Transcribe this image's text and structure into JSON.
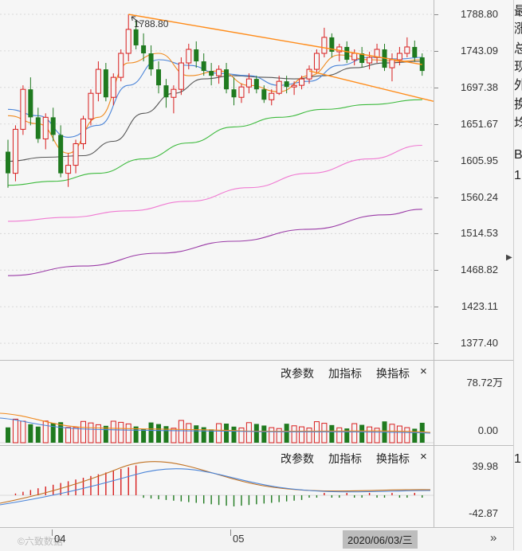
{
  "price_axis": {
    "labels": [
      "1788.80",
      "1743.09",
      "1697.38",
      "1651.67",
      "1605.95",
      "1560.24",
      "1514.53",
      "1468.82",
      "1423.11",
      "1377.40"
    ]
  },
  "high_marker": "1788.80",
  "panels": {
    "volume": {
      "buttons": [
        "改参数",
        "加指标",
        "换指标"
      ],
      "close": "×",
      "top_label": "78.72万",
      "bottom_label": "0.00"
    },
    "macd": {
      "buttons": [
        "改参数",
        "加指标",
        "换指标"
      ],
      "close": "×",
      "top_label": "39.98",
      "bottom_label": "-42.87"
    }
  },
  "time_axis": {
    "month_labels": [
      "04",
      "05"
    ],
    "date_badge": "2020/06/03/三",
    "scroll_glyph": "»"
  },
  "watermark": "©六致数据",
  "side_arrow": "▶",
  "right_clipped_chars": [
    "最",
    "涨",
    "总",
    "现",
    "外",
    "换",
    "均",
    "B",
    "1",
    "1"
  ],
  "colors": {
    "up": "#d81e1e",
    "down": "#1f7a1f",
    "ma5": "#f08a1e",
    "ma10": "#4a84d8",
    "ma20": "#555555",
    "ma60": "#3cba3c",
    "ma120": "#f07ad2",
    "ma250": "#9a3aa6",
    "trend": "#ff8c1a",
    "bg": "#f6f6f6"
  },
  "chart_data": {
    "type": "candlestick",
    "y_range": [
      1355,
      1800
    ],
    "candles": [
      [
        1617,
        1632,
        1572,
        1590
      ],
      [
        1590,
        1650,
        1580,
        1645
      ],
      [
        1645,
        1700,
        1638,
        1695
      ],
      [
        1695,
        1710,
        1650,
        1660
      ],
      [
        1660,
        1672,
        1628,
        1633
      ],
      [
        1633,
        1665,
        1620,
        1660
      ],
      [
        1660,
        1672,
        1630,
        1638
      ],
      [
        1638,
        1650,
        1585,
        1590
      ],
      [
        1590,
        1615,
        1573,
        1600
      ],
      [
        1600,
        1632,
        1590,
        1627
      ],
      [
        1627,
        1662,
        1620,
        1658
      ],
      [
        1658,
        1695,
        1650,
        1690
      ],
      [
        1690,
        1730,
        1680,
        1720
      ],
      [
        1720,
        1728,
        1680,
        1685
      ],
      [
        1685,
        1715,
        1675,
        1710
      ],
      [
        1710,
        1745,
        1705,
        1740
      ],
      [
        1740,
        1788.8,
        1730,
        1770
      ],
      [
        1770,
        1782,
        1745,
        1750
      ],
      [
        1750,
        1765,
        1730,
        1740
      ],
      [
        1740,
        1750,
        1712,
        1720
      ],
      [
        1720,
        1730,
        1690,
        1700
      ],
      [
        1700,
        1708,
        1672,
        1685
      ],
      [
        1685,
        1700,
        1665,
        1695
      ],
      [
        1695,
        1735,
        1688,
        1728
      ],
      [
        1728,
        1752,
        1720,
        1745
      ],
      [
        1745,
        1755,
        1722,
        1730
      ],
      [
        1730,
        1740,
        1712,
        1718
      ],
      [
        1718,
        1728,
        1700,
        1712
      ],
      [
        1712,
        1725,
        1702,
        1720
      ],
      [
        1720,
        1728,
        1690,
        1695
      ],
      [
        1695,
        1710,
        1675,
        1685
      ],
      [
        1685,
        1702,
        1678,
        1698
      ],
      [
        1698,
        1715,
        1690,
        1708
      ],
      [
        1708,
        1712,
        1690,
        1695
      ],
      [
        1695,
        1700,
        1678,
        1682
      ],
      [
        1682,
        1695,
        1675,
        1690
      ],
      [
        1690,
        1712,
        1688,
        1705
      ],
      [
        1705,
        1712,
        1690,
        1698
      ],
      [
        1698,
        1705,
        1688,
        1700
      ],
      [
        1700,
        1712,
        1695,
        1708
      ],
      [
        1708,
        1725,
        1702,
        1720
      ],
      [
        1720,
        1745,
        1715,
        1740
      ],
      [
        1740,
        1772,
        1735,
        1760
      ],
      [
        1760,
        1765,
        1735,
        1742
      ],
      [
        1742,
        1752,
        1730,
        1748
      ],
      [
        1748,
        1755,
        1728,
        1732
      ],
      [
        1732,
        1745,
        1725,
        1740
      ],
      [
        1740,
        1748,
        1722,
        1728
      ],
      [
        1728,
        1742,
        1720,
        1735
      ],
      [
        1735,
        1752,
        1728,
        1745
      ],
      [
        1745,
        1752,
        1718,
        1722
      ],
      [
        1722,
        1740,
        1705,
        1732
      ],
      [
        1732,
        1748,
        1725,
        1740
      ],
      [
        1740,
        1760,
        1735,
        1748
      ],
      [
        1748,
        1756,
        1730,
        1735
      ],
      [
        1735,
        1740,
        1712,
        1718
      ]
    ],
    "ma5": [
      [
        0,
        1662
      ],
      [
        4,
        1652
      ],
      [
        8,
        1615
      ],
      [
        12,
        1660
      ],
      [
        16,
        1728
      ],
      [
        20,
        1740
      ],
      [
        24,
        1712
      ],
      [
        28,
        1718
      ],
      [
        32,
        1700
      ],
      [
        36,
        1692
      ],
      [
        40,
        1712
      ],
      [
        44,
        1738
      ],
      [
        48,
        1732
      ],
      [
        52,
        1730
      ],
      [
        55,
        1732
      ]
    ],
    "ma10": [
      [
        0,
        1670
      ],
      [
        4,
        1662
      ],
      [
        8,
        1635
      ],
      [
        12,
        1650
      ],
      [
        16,
        1700
      ],
      [
        20,
        1732
      ],
      [
        24,
        1725
      ],
      [
        28,
        1715
      ],
      [
        32,
        1712
      ],
      [
        36,
        1700
      ],
      [
        40,
        1705
      ],
      [
        44,
        1725
      ],
      [
        48,
        1735
      ],
      [
        52,
        1733
      ],
      [
        55,
        1735
      ]
    ],
    "ma20": [
      [
        0,
        1605
      ],
      [
        5,
        1610
      ],
      [
        10,
        1612
      ],
      [
        14,
        1630
      ],
      [
        18,
        1665
      ],
      [
        22,
        1690
      ],
      [
        26,
        1708
      ],
      [
        30,
        1712
      ],
      [
        34,
        1710
      ],
      [
        38,
        1708
      ],
      [
        42,
        1712
      ],
      [
        46,
        1722
      ],
      [
        50,
        1728
      ],
      [
        55,
        1730
      ]
    ],
    "ma60": [
      [
        0,
        1575
      ],
      [
        6,
        1580
      ],
      [
        12,
        1590
      ],
      [
        18,
        1608
      ],
      [
        24,
        1628
      ],
      [
        30,
        1648
      ],
      [
        36,
        1660
      ],
      [
        42,
        1670
      ],
      [
        48,
        1676
      ],
      [
        55,
        1682
      ]
    ],
    "ma120": [
      [
        0,
        1530
      ],
      [
        8,
        1535
      ],
      [
        16,
        1543
      ],
      [
        24,
        1555
      ],
      [
        32,
        1572
      ],
      [
        40,
        1590
      ],
      [
        48,
        1608
      ],
      [
        55,
        1625
      ]
    ],
    "ma250": [
      [
        0,
        1462
      ],
      [
        10,
        1474
      ],
      [
        20,
        1490
      ],
      [
        30,
        1505
      ],
      [
        40,
        1520
      ],
      [
        50,
        1538
      ],
      [
        55,
        1545
      ]
    ],
    "trendline_upper": [
      [
        16,
        1788.8
      ],
      [
        55,
        1726
      ]
    ],
    "trendline_lower": [
      [
        40,
        1718
      ],
      [
        56.5,
        1680
      ]
    ],
    "volume_panel": {
      "ylim": [
        0,
        78.72
      ],
      "unit": "万"
    },
    "macd_panel": {
      "ylim": [
        -42.87,
        39.98
      ]
    }
  }
}
